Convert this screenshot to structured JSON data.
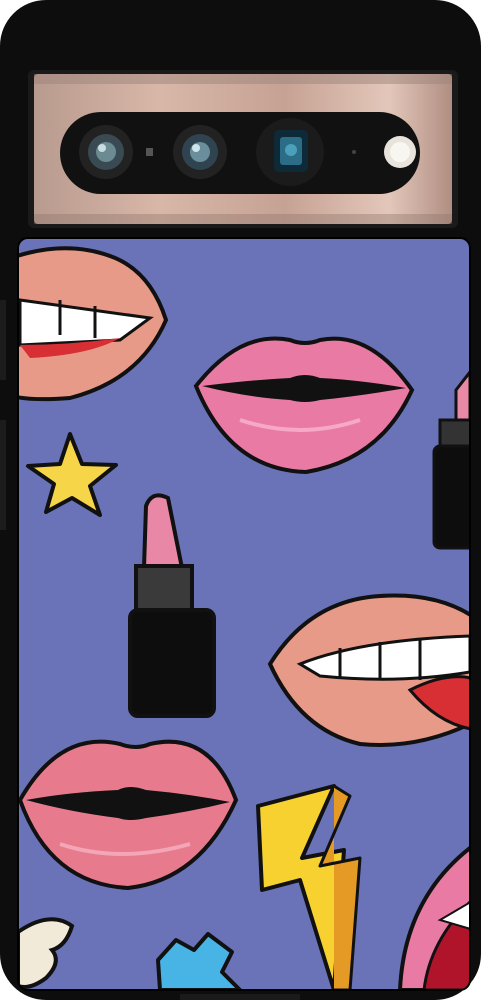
{
  "product": {
    "kind": "phone case",
    "case_color": "#0d0d0d",
    "print_background": "#6a72b8",
    "camera_bar_color": "#c9a698"
  },
  "artwork": {
    "motifs": [
      "lips-smile-icon",
      "lips-kiss-icon",
      "star-icon",
      "lipstick-icon",
      "lips-tongue-icon",
      "lightning-bolt-icon",
      "wing-icon",
      "blue-sticker-icon",
      "lips-open-mouth-icon",
      "lipstick-partial-icon"
    ]
  }
}
